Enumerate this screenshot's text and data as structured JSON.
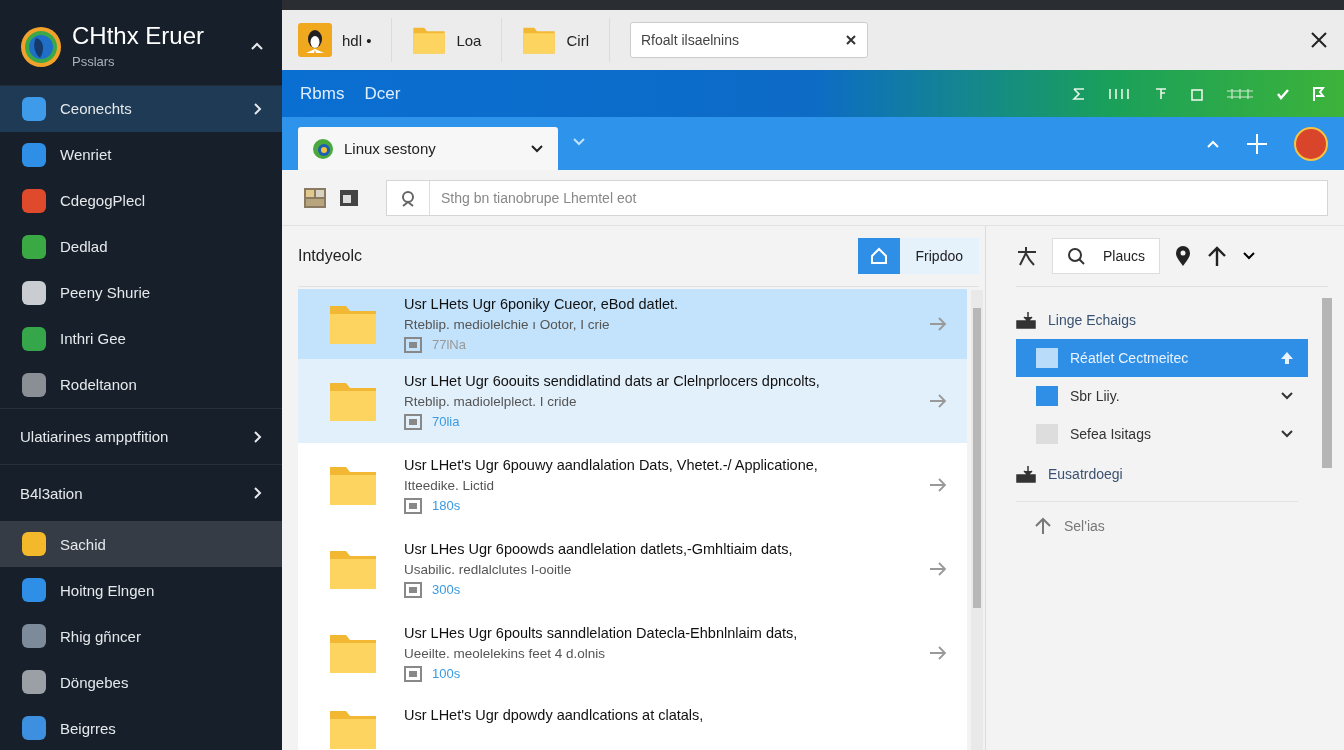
{
  "sidebar": {
    "app_name": "CHthx Eruer",
    "app_subtitle": "Psslars",
    "items": [
      {
        "kind": "app",
        "label": "Ceonechts",
        "color": "#3d9be9",
        "selected": true,
        "expandable": true
      },
      {
        "kind": "app",
        "label": "Wenriet",
        "color": "#2f8fe6",
        "selected": false,
        "expandable": false
      },
      {
        "kind": "app",
        "label": "CdegogPlecl",
        "color": "#e04a2c",
        "selected": false,
        "expandable": false
      },
      {
        "kind": "app",
        "label": "Dedlad",
        "color": "#3aa843",
        "selected": false,
        "expandable": false
      },
      {
        "kind": "app",
        "label": "Peeny Shurie",
        "color": "#c9ccd0",
        "selected": false,
        "expandable": false
      },
      {
        "kind": "app",
        "label": "Inthri Gee",
        "color": "#36a64a",
        "selected": false,
        "expandable": false
      },
      {
        "kind": "app",
        "label": "Rodeltanon",
        "color": "#8a8f96",
        "selected": false,
        "expandable": false
      },
      {
        "kind": "section",
        "label": "Ulatiarines ampptfition",
        "expandable": true
      },
      {
        "kind": "section",
        "label": "B4l3ation",
        "expandable": true
      },
      {
        "kind": "app",
        "label": "Sachid",
        "color": "#f4b92a",
        "selected": true,
        "expandable": false
      },
      {
        "kind": "app",
        "label": "Hoitng Elngen",
        "color": "#2f8fe6",
        "selected": false,
        "expandable": false
      },
      {
        "kind": "app",
        "label": "Rhig gñncer",
        "color": "#7d8a99",
        "selected": false,
        "expandable": false
      },
      {
        "kind": "app",
        "label": "Döngebes",
        "color": "#9aa0a6",
        "selected": false,
        "expandable": false
      },
      {
        "kind": "app",
        "label": "Beigrres",
        "color": "#3d8fe0",
        "selected": false,
        "expandable": false
      }
    ]
  },
  "top_tabs": [
    {
      "kind": "penguin",
      "label": "hdl •"
    },
    {
      "kind": "folder",
      "label": "Loa"
    },
    {
      "kind": "folder",
      "label": "Cirl"
    }
  ],
  "top_search": {
    "value": "Rfoalt ilsaelnins"
  },
  "menu": [
    "Rbms",
    "Dcer"
  ],
  "location_tab": {
    "label": "Linux sestony"
  },
  "search": {
    "placeholder": "Sthg bn tianobrupe Lhemtel eot"
  },
  "list": {
    "title": "Intdyeolc",
    "action": "Fripdoo",
    "rows": [
      {
        "title": "Usr LHets Ugr 6poniky Cueor, eBod datlet.",
        "subtitle": "Rteblip. mediolelchie ı Ootor, I crie",
        "meta": "77lNa",
        "selected": true,
        "hovered": false
      },
      {
        "title": "Usr LHet Ugr 6oouits sendidlatind dats ar Clelnprlocers dpncolts,",
        "subtitle": "Rteblip. madiolelplect. I cride",
        "meta": "70lia",
        "selected": false,
        "hovered": true
      },
      {
        "title": "Usr LHet's Ugr 6pouwy aandlalation Dats, Vhetet.-/ Applicatione,",
        "subtitle": "Itteedike. Lictid",
        "meta": "180s",
        "selected": false,
        "hovered": false
      },
      {
        "title": "Usr LHes Ugr 6poowds aandlelation datlets,-Gmhltiaim dats,",
        "subtitle": "Usabilic. redlalclutes I-ooitle",
        "meta": "300s",
        "selected": false,
        "hovered": false
      },
      {
        "title": "Usr LHes Ugr 6poults sanndlelation Datecla-Ehbnlnlaim dats,",
        "subtitle": "Ueeilte. meolelekins feet 4 d.olnis",
        "meta": "100s",
        "selected": false,
        "hovered": false
      },
      {
        "title": "Usr LHet's Ugr dpowdy aandlcations at clatals,",
        "selected": false,
        "hovered": false
      }
    ]
  },
  "places": {
    "search_label": "Plaucs",
    "tree": [
      {
        "kind": "header",
        "label": "Linge Echaigs",
        "children": [
          {
            "kind": "folder",
            "label": "Réatlet Cectmeitec",
            "selected": true,
            "expanded": true
          },
          {
            "kind": "folder",
            "label": "Sbr Liiy.",
            "selected": false,
            "expanded": false
          },
          {
            "kind": "folder",
            "label": "Sefea Isitags",
            "selected": false,
            "expanded": false
          }
        ]
      },
      {
        "kind": "header",
        "label": "Eusatrdoegi"
      },
      {
        "kind": "link",
        "label": "Sel'ias"
      }
    ]
  }
}
